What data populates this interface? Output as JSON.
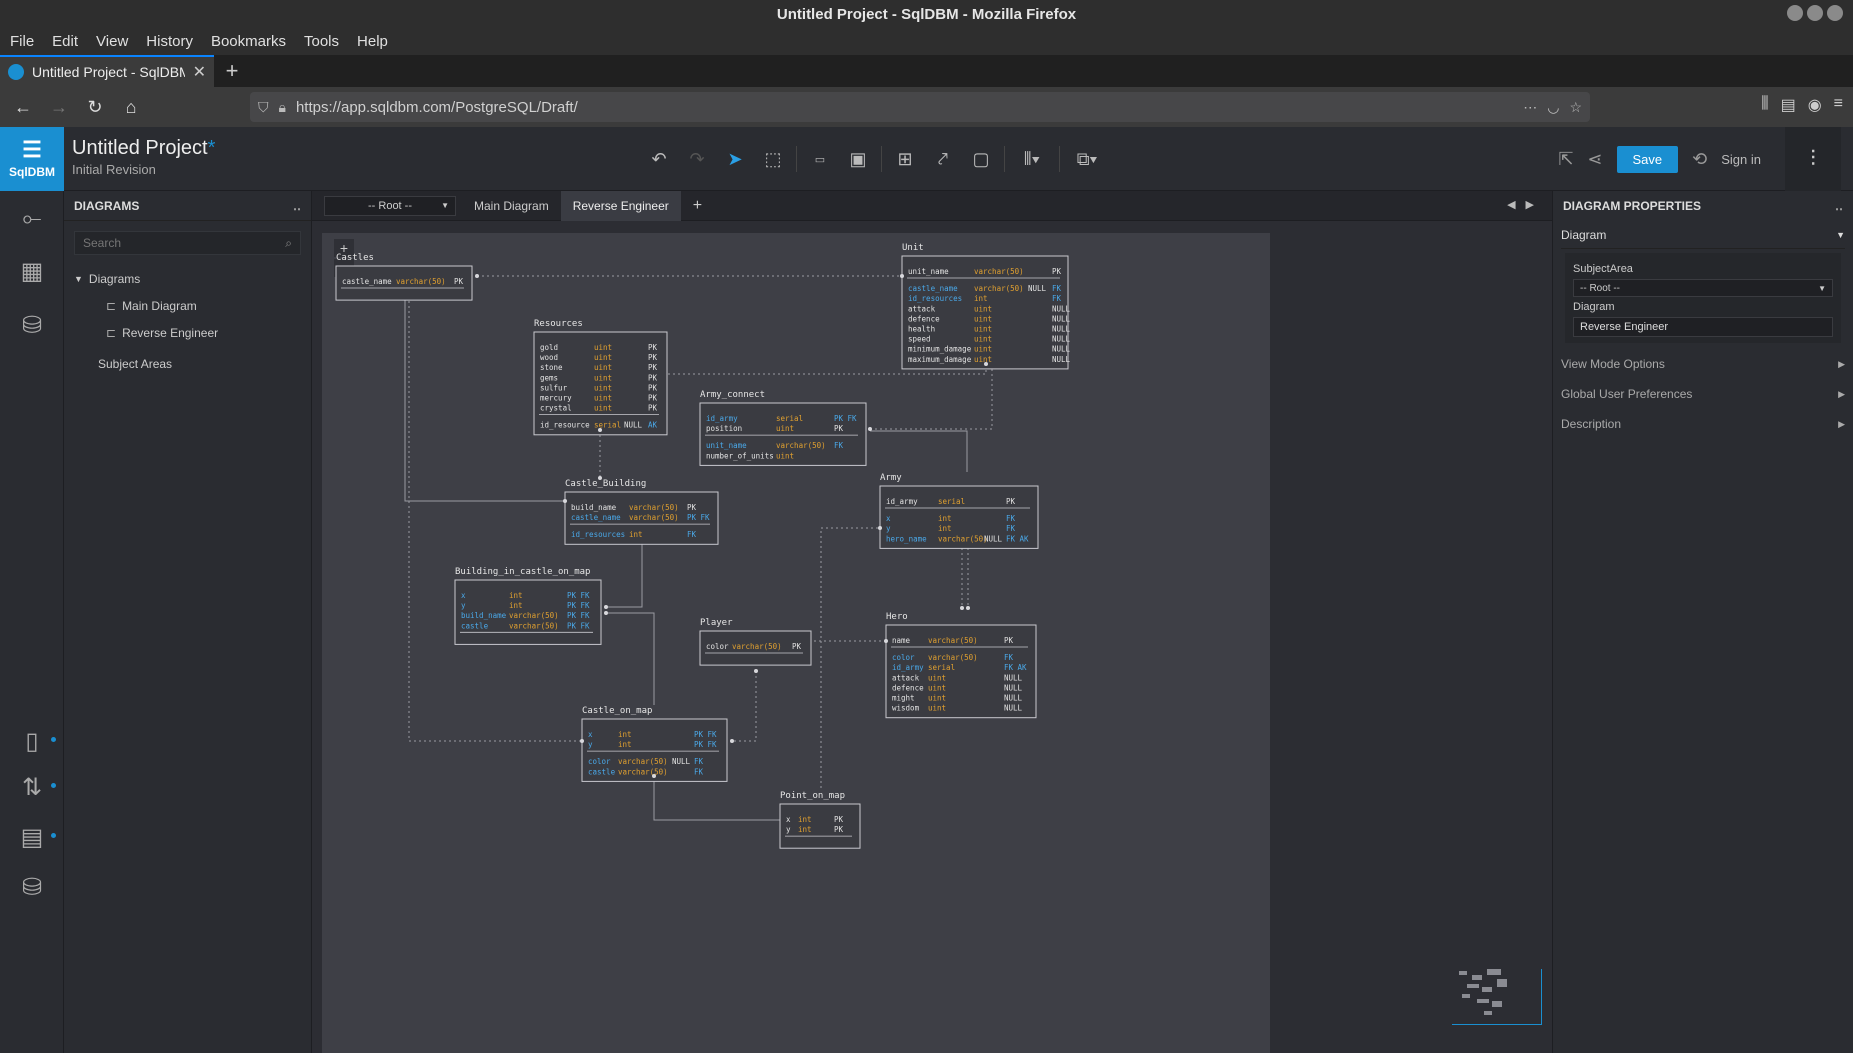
{
  "browser": {
    "window_title": "Untitled Project - SqlDBM - Mozilla Firefox",
    "menu": [
      "File",
      "Edit",
      "View",
      "History",
      "Bookmarks",
      "Tools",
      "Help"
    ],
    "tab_title": "Untitled Project - SqlDBM",
    "url": "https://app.sqldbm.com/PostgreSQL/Draft/"
  },
  "app": {
    "logo_text": "SqlDBM",
    "project_name": "Untitled Project",
    "project_modified_mark": "*",
    "revision": "Initial Revision",
    "save_label": "Save",
    "signin_label": "Sign in",
    "accent_color": "#1a8fd1"
  },
  "left_panel": {
    "title": "DIAGRAMS",
    "search_placeholder": "Search",
    "tree_root": "Diagrams",
    "items": [
      "Main Diagram",
      "Reverse Engineer"
    ],
    "subject_areas": "Subject Areas"
  },
  "canvas": {
    "root_select": "-- Root --",
    "tabs": [
      "Main Diagram",
      "Reverse Engineer"
    ],
    "add_tab": "+"
  },
  "tables": [
    {
      "name": "Castles",
      "rows": [
        [
          "castle_name",
          "varchar(50)",
          "",
          "PK"
        ]
      ]
    },
    {
      "name": "Unit",
      "rows": [
        [
          "unit_name",
          "varchar(50)",
          "",
          "PK"
        ],
        [
          "castle_name",
          "varchar(50)",
          "NULL",
          "FK"
        ],
        [
          "id_resources",
          "int",
          "",
          "FK"
        ],
        [
          "attack",
          "uint",
          "",
          "NULL"
        ],
        [
          "defence",
          "uint",
          "",
          "NULL"
        ],
        [
          "health",
          "uint",
          "",
          "NULL"
        ],
        [
          "speed",
          "uint",
          "",
          "NULL"
        ],
        [
          "minimum_damage",
          "uint",
          "",
          "NULL"
        ],
        [
          "maximum_damage",
          "uint",
          "",
          "NULL"
        ]
      ]
    },
    {
      "name": "Resources",
      "rows": [
        [
          "gold",
          "uint",
          "",
          "PK"
        ],
        [
          "wood",
          "uint",
          "",
          "PK"
        ],
        [
          "stone",
          "uint",
          "",
          "PK"
        ],
        [
          "gems",
          "uint",
          "",
          "PK"
        ],
        [
          "sulfur",
          "uint",
          "",
          "PK"
        ],
        [
          "mercury",
          "uint",
          "",
          "PK"
        ],
        [
          "crystal",
          "uint",
          "",
          "PK"
        ],
        [
          "id_resource",
          "serial",
          "NULL",
          "AK"
        ]
      ]
    },
    {
      "name": "Army_connect",
      "rows": [
        [
          "id_army",
          "serial",
          "",
          "PK FK"
        ],
        [
          "position",
          "uint",
          "",
          "PK"
        ],
        [
          "unit_name",
          "varchar(50)",
          "",
          "FK"
        ],
        [
          "number_of_units",
          "uint",
          "",
          ""
        ]
      ]
    },
    {
      "name": "Castle_Building",
      "rows": [
        [
          "build_name",
          "varchar(50)",
          "",
          "PK"
        ],
        [
          "castle_name",
          "varchar(50)",
          "",
          "PK FK"
        ],
        [
          "id_resources",
          "int",
          "",
          "FK"
        ]
      ]
    },
    {
      "name": "Army",
      "rows": [
        [
          "id_army",
          "serial",
          "",
          "PK"
        ],
        [
          "x",
          "int",
          "",
          "FK"
        ],
        [
          "y",
          "int",
          "",
          "FK"
        ],
        [
          "hero_name",
          "varchar(50)",
          "NULL",
          "FK AK"
        ]
      ]
    },
    {
      "name": "Building_in_castle_on_map",
      "rows": [
        [
          "x",
          "int",
          "",
          "PK FK"
        ],
        [
          "y",
          "int",
          "",
          "PK FK"
        ],
        [
          "build_name",
          "varchar(50)",
          "",
          "PK FK"
        ],
        [
          "castle",
          "varchar(50)",
          "",
          "PK FK"
        ]
      ]
    },
    {
      "name": "Player",
      "rows": [
        [
          "color",
          "varchar(50)",
          "",
          "PK"
        ]
      ]
    },
    {
      "name": "Hero",
      "rows": [
        [
          "name",
          "varchar(50)",
          "",
          "PK"
        ],
        [
          "color",
          "varchar(50)",
          "",
          "FK"
        ],
        [
          "id_army",
          "serial",
          "",
          "FK AK"
        ],
        [
          "attack",
          "uint",
          "",
          "NULL"
        ],
        [
          "defence",
          "uint",
          "",
          "NULL"
        ],
        [
          "might",
          "uint",
          "",
          "NULL"
        ],
        [
          "wisdom",
          "uint",
          "",
          "NULL"
        ]
      ]
    },
    {
      "name": "Castle_on_map",
      "rows": [
        [
          "x",
          "int",
          "",
          "PK FK"
        ],
        [
          "y",
          "int",
          "",
          "PK FK"
        ],
        [
          "color",
          "varchar(50)",
          "NULL",
          "FK"
        ],
        [
          "castle",
          "varchar(50)",
          "",
          "FK"
        ]
      ]
    },
    {
      "name": "Point_on_map",
      "rows": [
        [
          "x",
          "int",
          "",
          "PK"
        ],
        [
          "y",
          "int",
          "",
          "PK"
        ]
      ]
    }
  ],
  "right_panel": {
    "title": "DIAGRAM PROPERTIES",
    "section": "Diagram",
    "subject_area_label": "SubjectArea",
    "subject_area_value": "-- Root --",
    "diagram_label": "Diagram",
    "diagram_value": "Reverse Engineer",
    "collapsed": [
      "View Mode Options",
      "Global User Preferences",
      "Description"
    ]
  }
}
